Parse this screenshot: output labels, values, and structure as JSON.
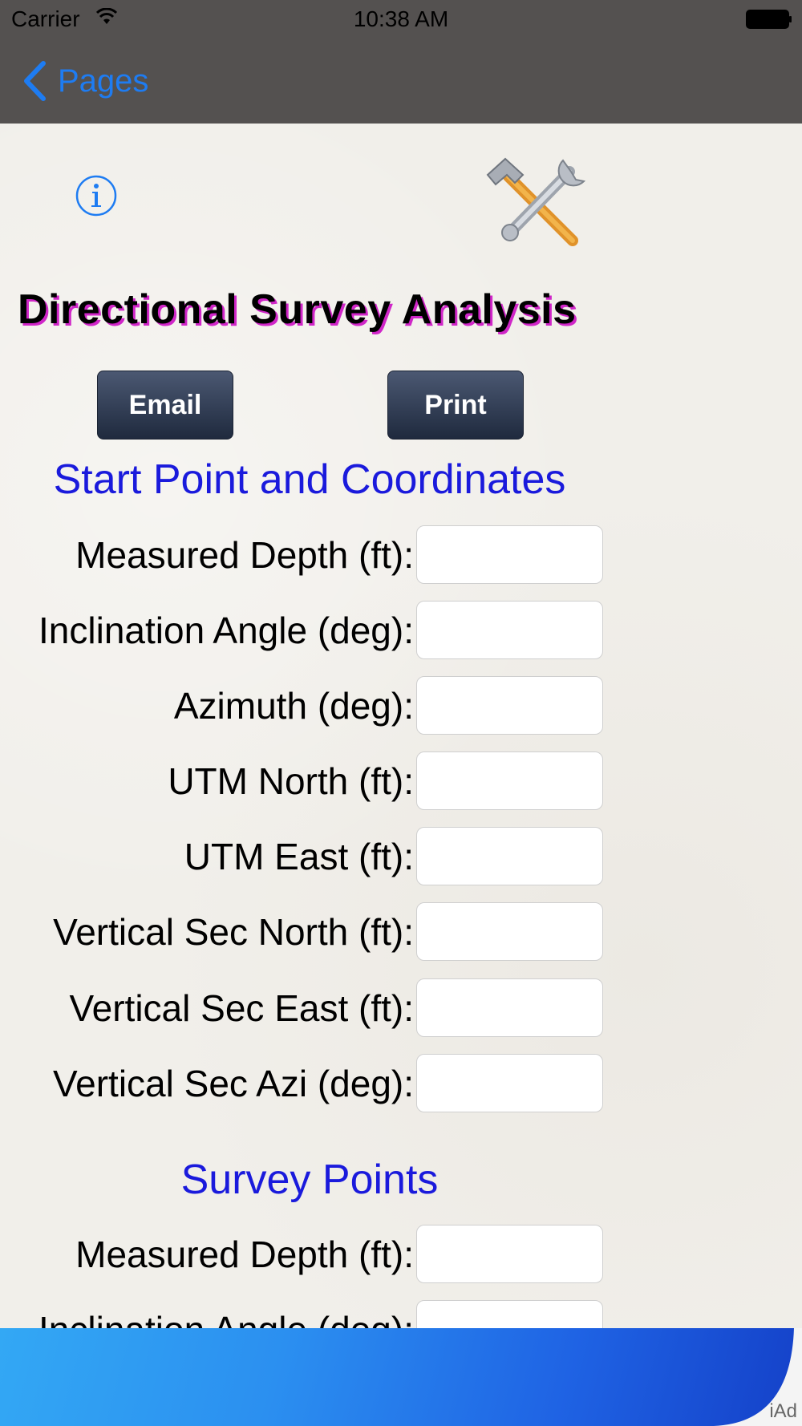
{
  "status_bar": {
    "carrier": "Carrier",
    "time": "10:38 AM"
  },
  "nav": {
    "back_label": "Pages"
  },
  "header": {
    "title": "Directional Survey Analysis",
    "email_label": "Email",
    "print_label": "Print"
  },
  "start_section": {
    "title": "Start Point and Coordinates",
    "fields": [
      {
        "label": "Measured Depth (ft):",
        "value": ""
      },
      {
        "label": "Inclination Angle (deg):",
        "value": ""
      },
      {
        "label": "Azimuth (deg):",
        "value": ""
      },
      {
        "label": "UTM North (ft):",
        "value": ""
      },
      {
        "label": "UTM East (ft):",
        "value": ""
      },
      {
        "label": "Vertical Sec North (ft):",
        "value": ""
      },
      {
        "label": "Vertical Sec East (ft):",
        "value": ""
      },
      {
        "label": "Vertical Sec Azi (deg):",
        "value": ""
      }
    ]
  },
  "survey_section": {
    "title": "Survey Points",
    "fields": [
      {
        "label": "Measured Depth (ft):",
        "value": ""
      },
      {
        "label": "Inclination Angle (deg):",
        "value": ""
      }
    ]
  },
  "ad": {
    "label": "iAd"
  },
  "colors": {
    "accent": "#1e7cf2",
    "section_title": "#1a1adc",
    "title_shadow": "#d026c8",
    "bar_bg": "#545150"
  }
}
